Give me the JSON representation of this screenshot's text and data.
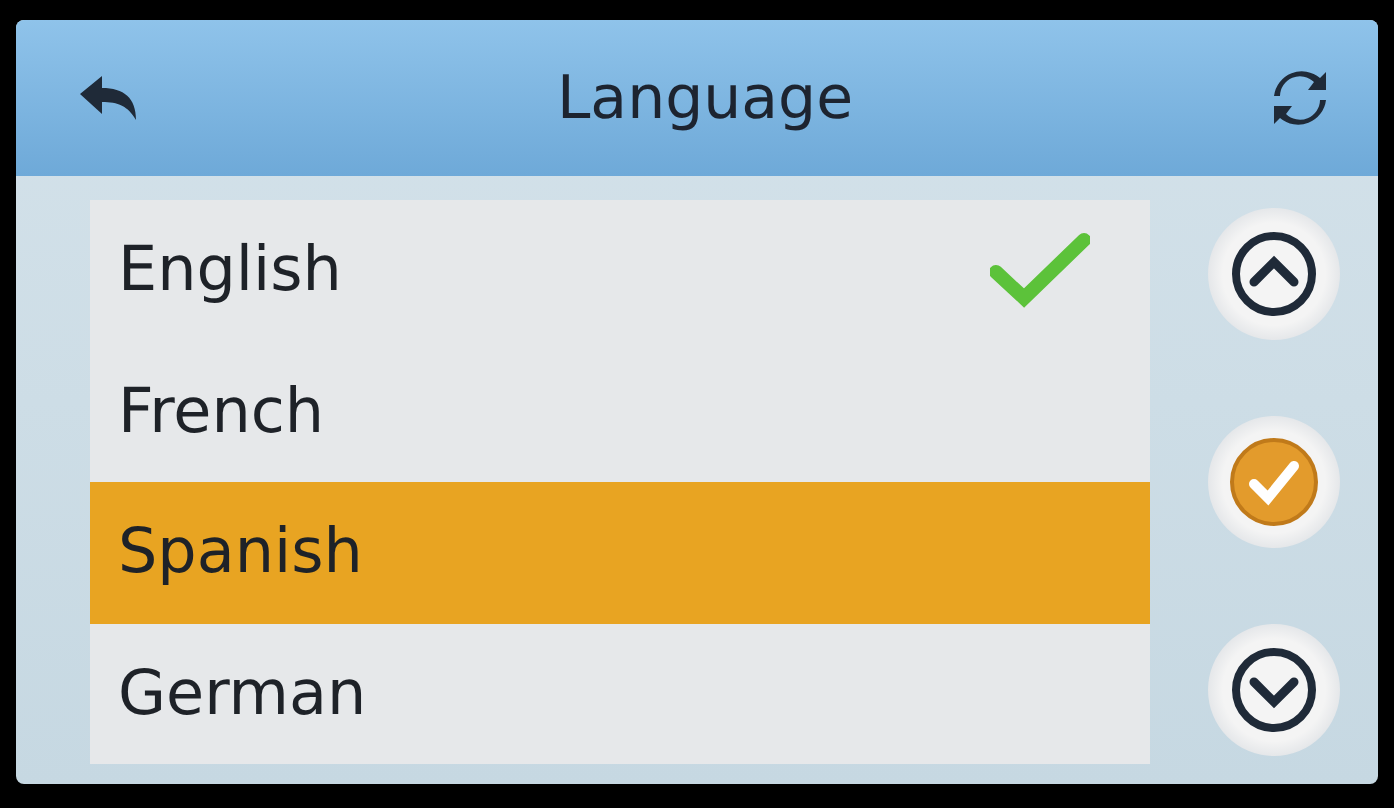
{
  "header": {
    "title": "Language"
  },
  "languages": [
    {
      "label": "English",
      "selected": false,
      "checked": true
    },
    {
      "label": "French",
      "selected": false,
      "checked": false
    },
    {
      "label": "Spanish",
      "selected": true,
      "checked": false
    },
    {
      "label": "German",
      "selected": false,
      "checked": false
    }
  ],
  "side_buttons": [
    {
      "kind": "up"
    },
    {
      "kind": "confirm"
    },
    {
      "kind": "down"
    }
  ]
}
